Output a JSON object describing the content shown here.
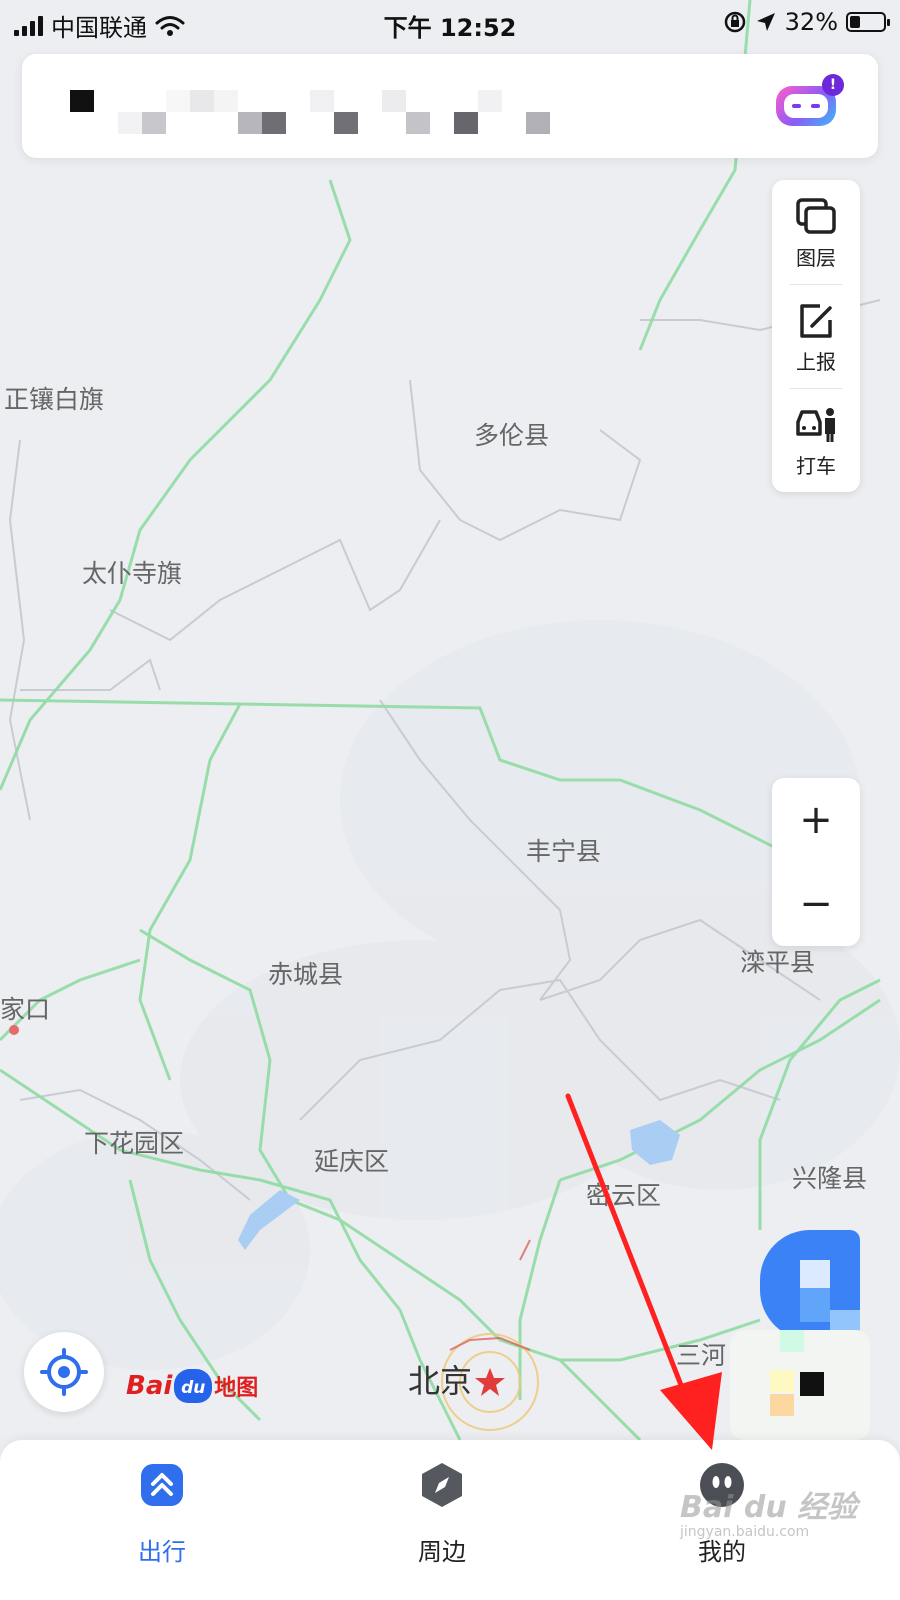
{
  "status_bar": {
    "carrier": "中国联通",
    "time": "下午 12:52",
    "battery_percent": "32%",
    "battery_level": 0.32
  },
  "search": {
    "assistant_badge": "!",
    "text_redacted": true
  },
  "map": {
    "labels": {
      "zhengxiang": "正镶白旗",
      "duolun": "多伦县",
      "taipusi": "太仆寺旗",
      "fengning": "丰宁县",
      "chicheng": "赤城县",
      "luanping": "滦平县",
      "zhangjiakou": "家口",
      "xiahuayuan": "下花园区",
      "yanqing": "延庆区",
      "miyun": "密云区",
      "xinglong": "兴隆县",
      "beijing": "北京",
      "sanhe": "三河"
    },
    "colors": {
      "road": "#8fdca2",
      "boundary": "#c8cbd2",
      "water": "#a9cdf3",
      "background": "#eceef1"
    }
  },
  "tools": {
    "layers": "图层",
    "report": "上报",
    "taxi": "打车"
  },
  "zoom": {
    "in": "+",
    "out": "−"
  },
  "logo": {
    "bai": "Bai",
    "du": "du",
    "ditu": "地图"
  },
  "bottom_nav": {
    "items": [
      {
        "label": "出行",
        "icon": "travel-icon",
        "active": true
      },
      {
        "label": "周边",
        "icon": "compass-icon",
        "active": false
      },
      {
        "label": "我的",
        "icon": "profile-icon",
        "active": false
      }
    ]
  },
  "watermark": {
    "main": "Bai du 经验",
    "sub": "jingyan.baidu.com"
  },
  "accent_color": "#2f6fed",
  "annotation_color": "#ff2020"
}
